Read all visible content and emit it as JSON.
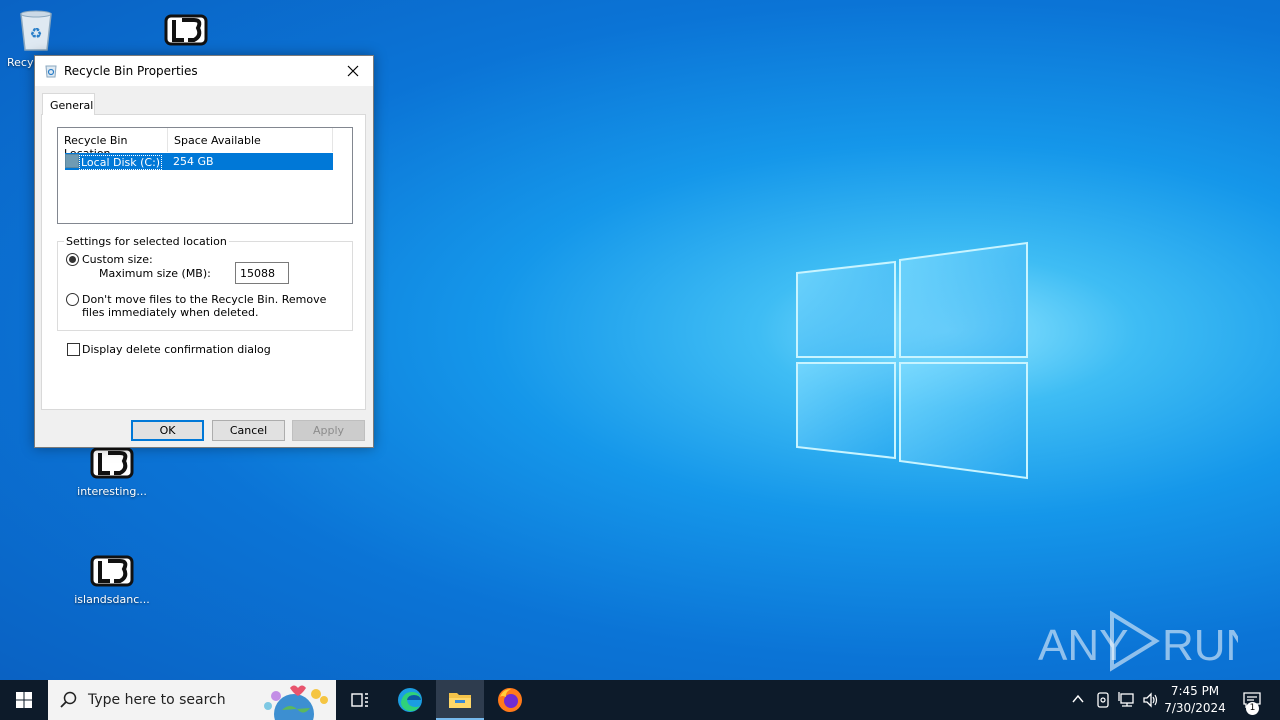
{
  "desktop": {
    "icons": [
      {
        "label": "Recycle Bin",
        "visible_label": "Recyc"
      },
      {
        "label": ""
      },
      {
        "label": "interesting..."
      },
      {
        "label": "islandsdanc..."
      }
    ],
    "watermark": "ANY RUN"
  },
  "dialog": {
    "title": "Recycle Bin Properties",
    "tab": "General",
    "list": {
      "columns": [
        "Recycle Bin Location",
        "Space Available"
      ],
      "rows": [
        {
          "location": "Local Disk (C:)",
          "space": "254 GB"
        }
      ]
    },
    "settings": {
      "group_label": "Settings for selected location",
      "custom_size_label": "Custom size:",
      "max_size_label": "Maximum size (MB):",
      "max_size_value": "15088",
      "no_move_label": "Don't move files to the Recycle Bin. Remove files immediately when deleted.",
      "custom_selected": true
    },
    "confirm_label": "Display delete confirmation dialog",
    "confirm_checked": false,
    "buttons": {
      "ok": "OK",
      "cancel": "Cancel",
      "apply": "Apply"
    }
  },
  "taskbar": {
    "search_placeholder": "Type here to search",
    "time": "7:45 PM",
    "date": "7/30/2024",
    "notification_count": "1",
    "pinned": [
      "task-view",
      "edge",
      "file-explorer",
      "firefox"
    ]
  },
  "colors": {
    "selection": "#0078d7",
    "taskbar": "#0d1b2a",
    "desktop": "#0b74d6"
  }
}
